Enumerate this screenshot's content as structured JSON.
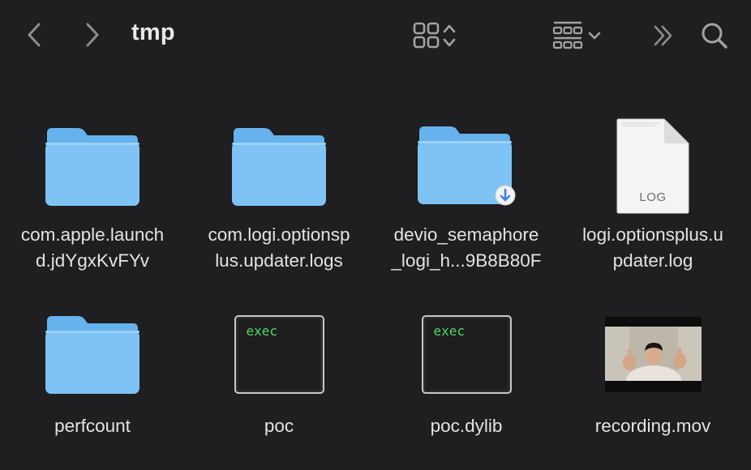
{
  "window": {
    "title": "tmp"
  },
  "toolbar": {
    "back_icon": "chevron-left-icon",
    "forward_icon": "chevron-right-icon",
    "view_icon": "grid-view-icon",
    "group_icon": "group-by-icon",
    "more_icon": "double-chevron-right-icon",
    "search_icon": "search-icon"
  },
  "colors": {
    "folder_front": "#7ec3f4",
    "folder_back": "#66b2ec",
    "exec_text": "#53d66a",
    "background": "#1f1e20"
  },
  "files": [
    {
      "name": "com.apple.launchd.jdYgxKvFYv",
      "line1": "com.apple.launch",
      "line2": "d.jdYgxKvFYv",
      "kind": "folder"
    },
    {
      "name": "com.logi.optionsplus.updater.logs",
      "line1": "com.logi.optionsp",
      "line2": "lus.updater.logs",
      "kind": "folder"
    },
    {
      "name": "devio_semaphore_logi_h...9B8B80F",
      "line1": "devio_semaphore",
      "line2": "_logi_h...9B8B80F",
      "kind": "folder-download"
    },
    {
      "name": "logi.optionsplus.updater.log",
      "line1": "logi.optionsplus.u",
      "line2": "pdater.log",
      "kind": "document",
      "doc_label": "LOG"
    },
    {
      "name": "perfcount",
      "line1": "perfcount",
      "kind": "folder"
    },
    {
      "name": "poc",
      "line1": "poc",
      "kind": "exec",
      "exec_label": "exec"
    },
    {
      "name": "poc.dylib",
      "line1": "poc.dylib",
      "kind": "exec",
      "exec_label": "exec"
    },
    {
      "name": "recording.mov",
      "line1": "recording.mov",
      "kind": "video"
    }
  ]
}
